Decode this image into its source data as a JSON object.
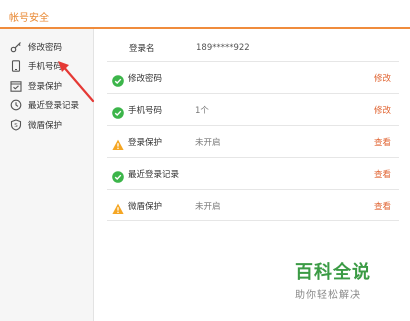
{
  "window": {
    "title": "帐号安全",
    "accent": "#f08c3c"
  },
  "sidebar": {
    "items": [
      {
        "label": "修改密码",
        "icon": "key-icon"
      },
      {
        "label": "手机号码",
        "icon": "phone-icon"
      },
      {
        "label": "登录保护",
        "icon": "calendar-check-icon"
      },
      {
        "label": "最近登录记录",
        "icon": "history-icon"
      },
      {
        "label": "微盾保护",
        "icon": "shield-icon"
      }
    ]
  },
  "account": {
    "label": "登录名",
    "value": "189*****922"
  },
  "rows": [
    {
      "name": "修改密码",
      "status": "ok",
      "value": "",
      "action": "修改"
    },
    {
      "name": "手机号码",
      "status": "ok",
      "value": "1个",
      "action": "修改"
    },
    {
      "name": "登录保护",
      "status": "warning",
      "value": "未开启",
      "action": "查看"
    },
    {
      "name": "最近登录记录",
      "status": "ok",
      "value": "",
      "action": "查看"
    },
    {
      "name": "微盾保护",
      "status": "warning",
      "value": "未开启",
      "action": "查看"
    }
  ],
  "watermark": {
    "title": "百科全说",
    "subtitle": "助你轻松解决"
  },
  "colors": {
    "ok": "#3cb54a",
    "warning": "#f5a623",
    "action": "#e0622f",
    "arrow": "#e53935"
  }
}
